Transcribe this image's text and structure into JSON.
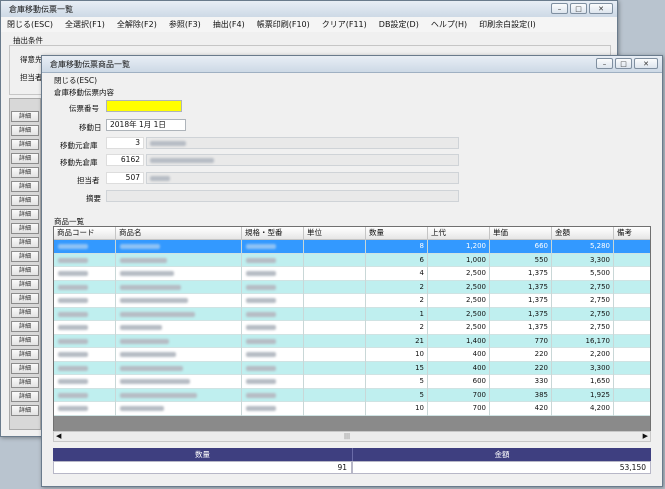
{
  "back_window": {
    "title": "倉庫移動伝票一覧",
    "menu": [
      "閉じる(ESC)",
      "全選択(F1)",
      "全解除(F2)",
      "参照(F3)",
      "抽出(F4)",
      "帳票印刷(F10)",
      "クリア(F11)",
      "DB設定(D)",
      "ヘルプ(H)",
      "印刷余白設定(I)"
    ],
    "section_label": "抽出条件",
    "label_customer": "得意先",
    "label_person": "担当者",
    "detail_button_label": "詳細"
  },
  "front_window": {
    "title": "倉庫移動伝票商品一覧",
    "menu_close": "閉じる(ESC)",
    "section_title": "倉庫移動伝票内容",
    "fields": {
      "slip_no_label": "伝票番号",
      "slip_no_value": "",
      "move_date_label": "移動日",
      "move_date_value": "2018年 1月 1日",
      "from_wh_label": "移動元倉庫",
      "from_wh_code": "3",
      "to_wh_label": "移動先倉庫",
      "to_wh_code": "6162",
      "person_label": "担当者",
      "person_code": "507",
      "memo_label": "摘要"
    },
    "list_title": "商品一覧",
    "columns": [
      "商品コード",
      "商品名",
      "規格・型番",
      "単位",
      "数量",
      "上代",
      "単価",
      "金額",
      "備考"
    ],
    "rows": [
      {
        "qty": "8",
        "list": "1,200",
        "unit": "660",
        "amount": "5,280"
      },
      {
        "qty": "6",
        "list": "1,000",
        "unit": "550",
        "amount": "3,300"
      },
      {
        "qty": "4",
        "list": "2,500",
        "unit": "1,375",
        "amount": "5,500"
      },
      {
        "qty": "2",
        "list": "2,500",
        "unit": "1,375",
        "amount": "2,750"
      },
      {
        "qty": "2",
        "list": "2,500",
        "unit": "1,375",
        "amount": "2,750"
      },
      {
        "qty": "1",
        "list": "2,500",
        "unit": "1,375",
        "amount": "2,750"
      },
      {
        "qty": "2",
        "list": "2,500",
        "unit": "1,375",
        "amount": "2,750"
      },
      {
        "qty": "21",
        "list": "1,400",
        "unit": "770",
        "amount": "16,170"
      },
      {
        "qty": "10",
        "list": "400",
        "unit": "220",
        "amount": "2,200"
      },
      {
        "qty": "15",
        "list": "400",
        "unit": "220",
        "amount": "3,300"
      },
      {
        "qty": "5",
        "list": "600",
        "unit": "330",
        "amount": "1,650"
      },
      {
        "qty": "5",
        "list": "700",
        "unit": "385",
        "amount": "1,925"
      },
      {
        "qty": "10",
        "list": "700",
        "unit": "420",
        "amount": "4,200"
      }
    ],
    "summary": {
      "qty_label": "数量",
      "qty_value": "91",
      "amount_label": "金額",
      "amount_value": "53,150"
    },
    "colors": {
      "selected_row": "#3399ff",
      "row_odd": "#ffffff",
      "row_even": "#bfefef",
      "slip_input": "#ffff00"
    }
  }
}
